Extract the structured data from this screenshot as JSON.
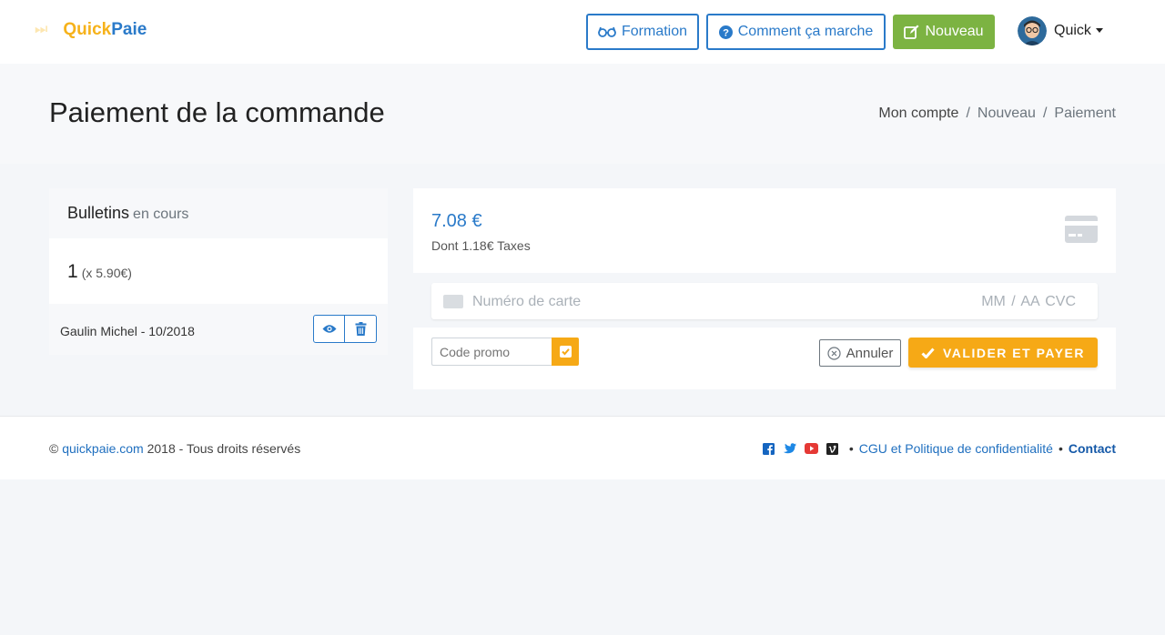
{
  "header": {
    "logo_part1": "Quick",
    "logo_part2": "Paie",
    "logo_mark": "⏭",
    "btn_formation": "Formation",
    "btn_how": "Comment ça marche",
    "btn_new": "Nouveau",
    "user_name": "Quick"
  },
  "page": {
    "title": "Paiement de la commande",
    "breadcrumb": [
      "Mon compte",
      "/",
      "Nouveau",
      "/",
      "Paiement"
    ]
  },
  "summary": {
    "title": "Bulletins",
    "subtitle": "en cours",
    "count": "1",
    "unit_price": "(x 5.90€)",
    "items": [
      {
        "label": "Gaulin Michel - 10/2018"
      }
    ]
  },
  "payment": {
    "amount": "7.08 €",
    "taxes": "Dont 1.18€ Taxes",
    "card_placeholder": "Numéro de carte",
    "card_right_placeholder": "MM / AA  CVC",
    "promo_placeholder": "Code promo",
    "cancel_label": "Annuler",
    "pay_label": "VALIDER ET PAYER"
  },
  "footer": {
    "copyright": "©",
    "site": "quickpaie.com",
    "rights": "2018 - Tous droits réservés",
    "separator": "•",
    "cgu": "CGU et Politique de confidentialité",
    "contact": "Contact",
    "social_icons": [
      "facebook-icon",
      "twitter-icon",
      "youtube-icon",
      "vimeo-icon"
    ]
  },
  "colors": {
    "brand_blue": "#2a7ac9",
    "brand_orange": "#f6a916",
    "green": "#7cb342"
  }
}
